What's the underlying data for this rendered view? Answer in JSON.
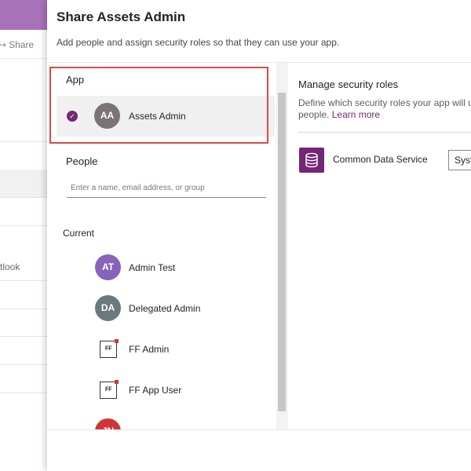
{
  "background": {
    "share_label": "Share",
    "share_icon": "share-icon",
    "outlook_text": "tlook",
    "topbar_color": "#a872b8"
  },
  "panel": {
    "title": "Share Assets Admin",
    "subtitle": "Add people and assign security roles so that they can use your app."
  },
  "app_section": {
    "label": "App",
    "app": {
      "initials": "AA",
      "name": "Assets Admin",
      "selected": true,
      "avatar_color": "#7a7574"
    }
  },
  "people_section": {
    "label": "People",
    "search_placeholder": "Enter a name, email address, or group"
  },
  "current_section": {
    "label": "Current",
    "users": [
      {
        "initials": "AT",
        "name": "Admin Test",
        "avatar_color": "#8764b8",
        "icon": "avatar"
      },
      {
        "initials": "DA",
        "name": "Delegated Admin",
        "avatar_color": "#69797e",
        "icon": "avatar"
      },
      {
        "initials": "FF",
        "name": "FF Admin",
        "icon": "ff-logo-icon"
      },
      {
        "initials": "FF",
        "name": "FF App User",
        "icon": "ff-logo-icon"
      },
      {
        "initials": "JN",
        "name": "",
        "avatar_color": "#d13438",
        "icon": "avatar"
      }
    ]
  },
  "security_roles": {
    "title": "Manage security roles",
    "description": "Define which security roles your app will us",
    "description_line2": "people.",
    "learn_more": "Learn more",
    "service_name": "Common Data Service",
    "service_icon": "database-icon",
    "role_select_value": "Syst",
    "accent_color": "#742774"
  }
}
